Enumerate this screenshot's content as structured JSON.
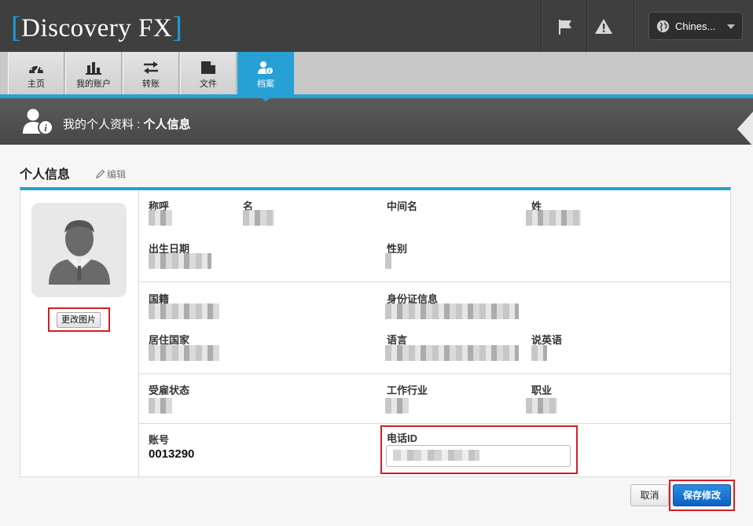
{
  "app": {
    "logo_text": "Discovery FX",
    "language": "Chines..."
  },
  "nav": {
    "tabs": [
      {
        "label": "主页",
        "icon": "dashboard-icon"
      },
      {
        "label": "我的账户",
        "icon": "bar-chart-icon"
      },
      {
        "label": "转账",
        "icon": "transfer-arrows-icon"
      },
      {
        "label": "文件",
        "icon": "folder-icon"
      },
      {
        "label": "档案",
        "icon": "user-info-icon",
        "active": true
      }
    ]
  },
  "banner": {
    "prefix": "我的个人资料 : ",
    "current": "个人信息"
  },
  "section": {
    "title": "个人信息",
    "edit_label": "编辑"
  },
  "profile": {
    "change_picture": "更改图片",
    "fields": {
      "salutation": "称呼",
      "first_name": "名",
      "middle_name": "中间名",
      "last_name": "姓",
      "birth_date": "出生日期",
      "gender": "性别",
      "nationality": "国籍",
      "id_info": "身份证信息",
      "residence_country": "居住国家",
      "language": "语言",
      "speaks_english": "说英语",
      "employment_status": "受雇状态",
      "industry": "工作行业",
      "occupation": "职业",
      "account_no_label": "账号",
      "phone_id_label": "电话ID"
    },
    "account_no": "0013290"
  },
  "actions": {
    "cancel": "取消",
    "save": "保存修改"
  },
  "colors": {
    "accent": "#27a0d6",
    "highlight": "#d21f26",
    "save_button": "#0d5fc4"
  }
}
